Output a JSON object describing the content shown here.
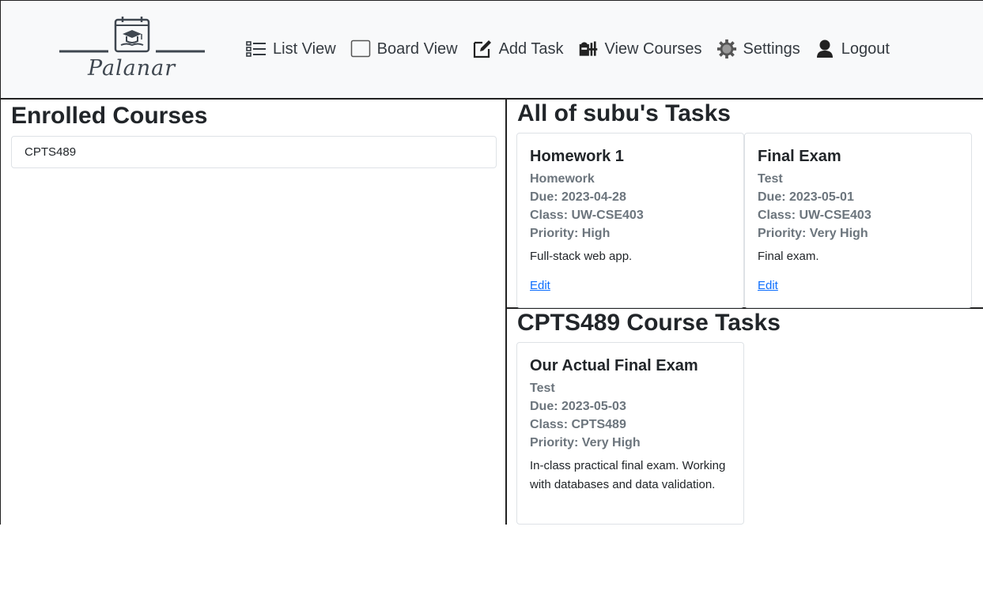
{
  "brand": {
    "name": "Palanar"
  },
  "nav": {
    "items": [
      {
        "label": "List View",
        "icon": "list-icon"
      },
      {
        "label": "Board View",
        "icon": "board-icon"
      },
      {
        "label": "Add Task",
        "icon": "edit-icon"
      },
      {
        "label": "View Courses",
        "icon": "students-icon"
      },
      {
        "label": "Settings",
        "icon": "gear-icon"
      },
      {
        "label": "Logout",
        "icon": "user-icon"
      }
    ]
  },
  "enrolled": {
    "title": "Enrolled Courses",
    "courses": [
      "CPTS489"
    ]
  },
  "all_tasks": {
    "title": "All of subu's Tasks",
    "cards": [
      {
        "title": "Homework 1",
        "type": "Homework",
        "due": "Due: 2023-04-28",
        "class": "Class: UW-CSE403",
        "priority": "Priority: High",
        "description": "Full-stack web app.",
        "link": "Edit"
      },
      {
        "title": "Final Exam",
        "type": "Test",
        "due": "Due: 2023-05-01",
        "class": "Class: UW-CSE403",
        "priority": "Priority: Very High",
        "description": "Final exam.",
        "link": "Edit"
      }
    ]
  },
  "course_tasks": {
    "title": "CPTS489 Course Tasks",
    "cards": [
      {
        "title": "Our Actual Final Exam",
        "type": "Test",
        "due": "Due: 2023-05-03",
        "class": "Class: CPTS489",
        "priority": "Priority: Very High",
        "description": "In-class practical final exam. Working with databases and data validation."
      }
    ]
  },
  "colors": {
    "header_bg": "#f8f9fa",
    "link": "#0d6efd",
    "muted": "#6c757d",
    "border": "#222222"
  }
}
